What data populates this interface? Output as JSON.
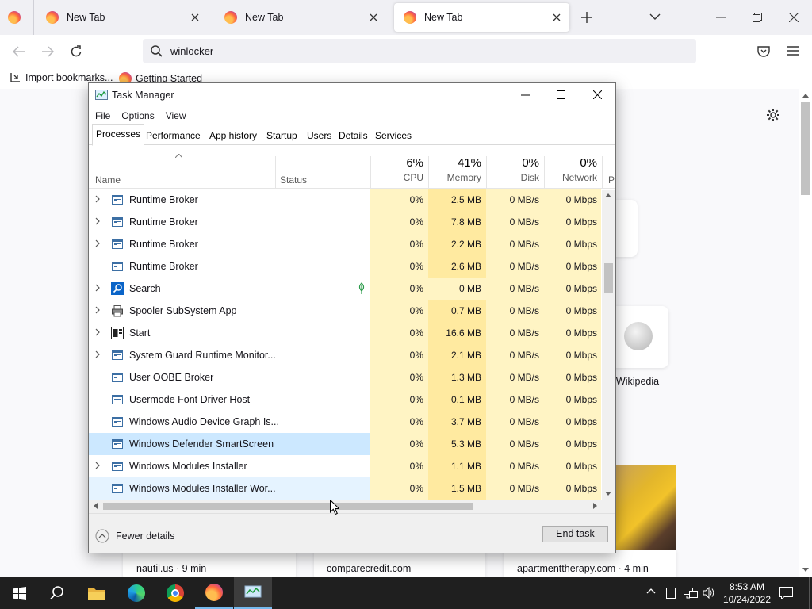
{
  "browser": {
    "tabs": [
      {
        "title": "New Tab"
      },
      {
        "title": "New Tab"
      },
      {
        "title": "New Tab"
      }
    ],
    "url": "winlocker",
    "bookmarks": [
      "Import bookmarks...",
      "Getting Started"
    ],
    "shortcuts": [
      {
        "label": "Wikipedia"
      }
    ],
    "stories": [
      {
        "source": "nautil.us · 9 min"
      },
      {
        "source": "comparecredit.com"
      },
      {
        "source": "apartmenttherapy.com · 4 min"
      }
    ]
  },
  "taskmanager": {
    "title": "Task Manager",
    "menu": [
      "File",
      "Options",
      "View"
    ],
    "tabs": [
      "Processes",
      "Performance",
      "App history",
      "Startup",
      "Users",
      "Details",
      "Services"
    ],
    "active_tab": "Processes",
    "columns": {
      "name": "Name",
      "status": "Status",
      "cpu": {
        "pct": "6%",
        "label": "CPU"
      },
      "memory": {
        "pct": "41%",
        "label": "Memory"
      },
      "disk": {
        "pct": "0%",
        "label": "Disk"
      },
      "network": {
        "pct": "0%",
        "label": "Network"
      },
      "power": {
        "label": "P"
      }
    },
    "rows": [
      {
        "name": "Runtime Broker",
        "expandable": true,
        "cpu": "0%",
        "memory": "2.5 MB",
        "disk": "0 MB/s",
        "network": "0 Mbps",
        "icon": "app-window-icon"
      },
      {
        "name": "Runtime Broker",
        "expandable": true,
        "cpu": "0%",
        "memory": "7.8 MB",
        "disk": "0 MB/s",
        "network": "0 Mbps",
        "icon": "app-window-icon"
      },
      {
        "name": "Runtime Broker",
        "expandable": true,
        "cpu": "0%",
        "memory": "2.2 MB",
        "disk": "0 MB/s",
        "network": "0 Mbps",
        "icon": "app-window-icon"
      },
      {
        "name": "Runtime Broker",
        "expandable": false,
        "cpu": "0%",
        "memory": "2.6 MB",
        "disk": "0 MB/s",
        "network": "0 Mbps",
        "icon": "app-window-icon"
      },
      {
        "name": "Search",
        "expandable": true,
        "cpu": "0%",
        "memory": "0 MB",
        "disk": "0 MB/s",
        "network": "0 Mbps",
        "icon": "search-app-icon",
        "status_icon": "leaf-icon"
      },
      {
        "name": "Spooler SubSystem App",
        "expandable": true,
        "cpu": "0%",
        "memory": "0.7 MB",
        "disk": "0 MB/s",
        "network": "0 Mbps",
        "icon": "printer-icon"
      },
      {
        "name": "Start",
        "expandable": true,
        "cpu": "0%",
        "memory": "16.6 MB",
        "disk": "0 MB/s",
        "network": "0 Mbps",
        "icon": "start-app-icon"
      },
      {
        "name": "System Guard Runtime Monitor...",
        "expandable": true,
        "cpu": "0%",
        "memory": "2.1 MB",
        "disk": "0 MB/s",
        "network": "0 Mbps",
        "icon": "app-window-icon"
      },
      {
        "name": "User OOBE Broker",
        "expandable": false,
        "cpu": "0%",
        "memory": "1.3 MB",
        "disk": "0 MB/s",
        "network": "0 Mbps",
        "icon": "app-window-icon"
      },
      {
        "name": "Usermode Font Driver Host",
        "expandable": false,
        "cpu": "0%",
        "memory": "0.1 MB",
        "disk": "0 MB/s",
        "network": "0 Mbps",
        "icon": "app-window-icon"
      },
      {
        "name": "Windows Audio Device Graph Is...",
        "expandable": false,
        "cpu": "0%",
        "memory": "3.7 MB",
        "disk": "0 MB/s",
        "network": "0 Mbps",
        "icon": "app-window-icon"
      },
      {
        "name": "Windows Defender SmartScreen",
        "expandable": false,
        "cpu": "0%",
        "memory": "5.3 MB",
        "disk": "0 MB/s",
        "network": "0 Mbps",
        "icon": "app-window-icon",
        "state": "selected"
      },
      {
        "name": "Windows Modules Installer",
        "expandable": true,
        "cpu": "0%",
        "memory": "1.1 MB",
        "disk": "0 MB/s",
        "network": "0 Mbps",
        "icon": "app-window-icon"
      },
      {
        "name": "Windows Modules Installer Wor...",
        "expandable": false,
        "cpu": "0%",
        "memory": "1.5 MB",
        "disk": "0 MB/s",
        "network": "0 Mbps",
        "icon": "app-window-icon",
        "state": "hover"
      }
    ],
    "fewer_details": "Fewer details",
    "end_task": "End task"
  },
  "taskbar": {
    "time": "8:53 AM",
    "date": "10/24/2022",
    "pinned": [
      "windows-start-icon",
      "search-icon",
      "file-explorer-icon",
      "edge-icon",
      "chrome-icon",
      "firefox-icon",
      "task-manager-icon"
    ]
  },
  "colors": {
    "cpu_cell": "#fff4c4",
    "mem_cell": "#ffeaa0",
    "selected_row": "#cce8ff",
    "taskbar": "#1f1f1f"
  }
}
